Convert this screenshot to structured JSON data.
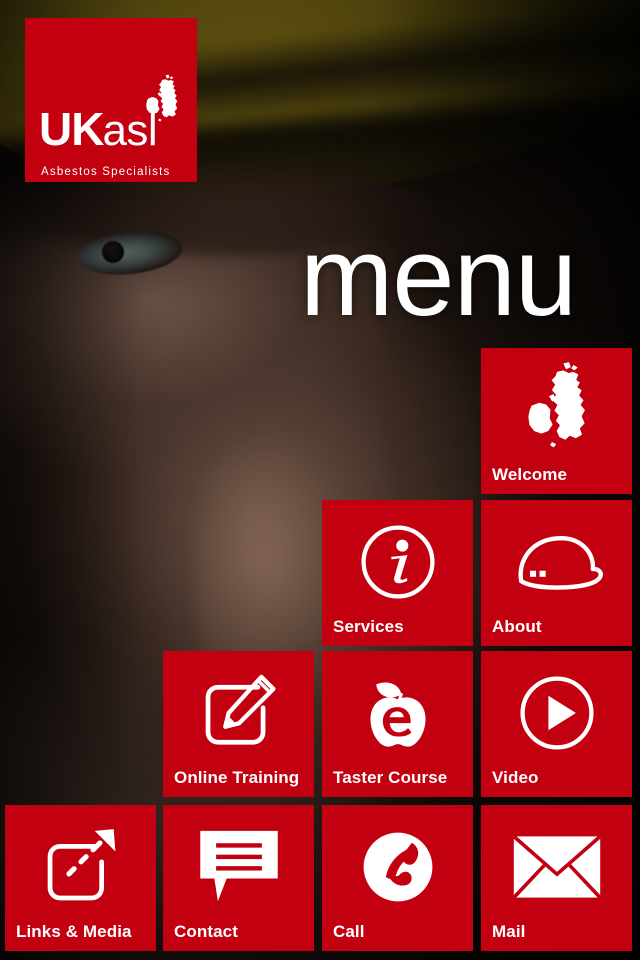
{
  "app": {
    "title": "UKasl Asbestos Specialists",
    "accent_red": "#c3000f",
    "background_description": "dark close-up photograph of an older man wearing a yellow hard hat"
  },
  "logo": {
    "name": "ukasl-logo",
    "uk_text": "UK",
    "asl_text": "asl",
    "tagline": "Asbestos Specialists",
    "map_icon": "uk-map-icon"
  },
  "header": {
    "title": "menu"
  },
  "menu": {
    "tiles": [
      {
        "id": "welcome",
        "label": "Welcome",
        "icon": "uk-map-icon"
      },
      {
        "id": "services",
        "label": "Services",
        "icon": "info-circle-icon"
      },
      {
        "id": "about",
        "label": "About",
        "icon": "hard-hat-icon"
      },
      {
        "id": "online-training",
        "label": "Online Training",
        "icon": "pencil-edit-icon"
      },
      {
        "id": "taster-course",
        "label": "Taster Course",
        "icon": "apple-e-learning-icon"
      },
      {
        "id": "video",
        "label": "Video",
        "icon": "play-circle-icon"
      },
      {
        "id": "links-media",
        "label": "Links & Media",
        "icon": "external-link-icon"
      },
      {
        "id": "contact",
        "label": "Contact",
        "icon": "speech-bubble-icon"
      },
      {
        "id": "call",
        "label": "Call",
        "icon": "phone-circle-icon"
      },
      {
        "id": "mail",
        "label": "Mail",
        "icon": "envelope-icon"
      }
    ]
  }
}
